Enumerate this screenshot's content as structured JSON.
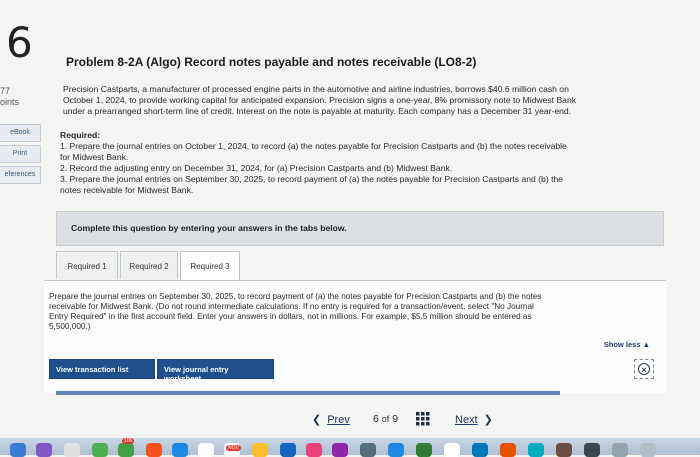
{
  "question": {
    "number": "6",
    "points_value": "77",
    "points_label": "oints"
  },
  "left_sidebar": {
    "items": [
      "eBook",
      "Print",
      "eferences"
    ]
  },
  "problem": {
    "title": "Problem 8-2A (Algo) Record notes payable and notes receivable (LO8-2)",
    "description": [
      "Precision Castparts, a manufacturer of processed engine parts in the automotive and airline industries, borrows $40.6 million cash on",
      "October 1, 2024, to provide working capital for anticipated expansion. Precision signs a one-year, 8% promissory note to Midwest Bank",
      "under a prearranged short-term line of credit. Interest on the note is payable at maturity. Each company has a December 31 year-end."
    ],
    "required_heading": "Required:",
    "required_items": [
      "1. Prepare the journal entries on October 1, 2024, to record (a) the notes payable for Precision Castparts and (b) the notes receivable",
      "for Midwest Bank.",
      "2. Record the adjusting entry on December 31, 2024, for (a) Precision Castparts and (b) Midwest Bank.",
      "3. Prepare the journal entries on September 30, 2025, to record payment of (a) the notes payable for Precision Castparts and (b) the",
      "notes receivable for Midwest Bank."
    ]
  },
  "complete_banner": "Complete this question by entering your answers in the tabs below.",
  "tabs": [
    {
      "label": "Required 1",
      "active": false
    },
    {
      "label": "Required 2",
      "active": false
    },
    {
      "label": "Required 3",
      "active": true
    }
  ],
  "instructions": [
    "Prepare the journal entries on September 30, 2025, to record payment of (a) the notes payable for Precision Castparts and (b) the notes",
    "receivable for Midwest Bank. (Do not round intermediate calculations. If no entry is required for a transaction/event, select \"No Journal",
    "Entry Required\" in the first account field. Enter your answers in dollars, not in millions. For example, $5.5 million should be entered as",
    "5,500,000.)"
  ],
  "show_less": "Show less ▲",
  "buttons": {
    "view_transaction_list": "View transaction list",
    "view_journal_worksheet": "View journal entry worksheet"
  },
  "pagination": {
    "prev": "Prev",
    "current": "6",
    "of_label": "of",
    "total": "9",
    "next": "Next"
  },
  "dock": {
    "badge_1": "106",
    "badge_2": "NOV"
  },
  "colors": {
    "primary_button": "#1f4f8c",
    "link": "#1f3a60",
    "banner_bg": "#dde0e3",
    "progress": "#5f88b8"
  }
}
